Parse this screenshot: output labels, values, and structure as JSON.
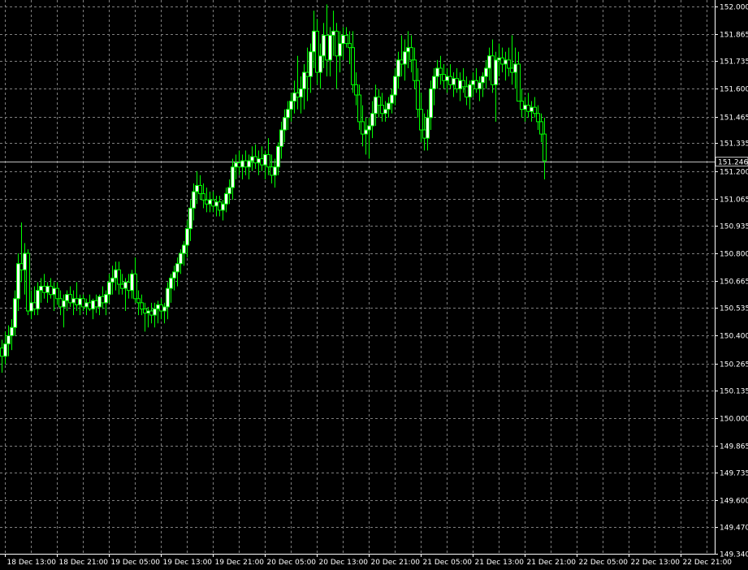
{
  "chart_data": {
    "type": "candlestick",
    "grid": true,
    "colors": {
      "background": "#000000",
      "grid": "#7f7f7f",
      "bull_body": "#ffffff",
      "bear_body": "#000000",
      "candle_outline": "#00ff00",
      "wick": "#00ff00",
      "axis_text": "#ffffff",
      "bid_line": "#c0c0c0"
    },
    "ylim": [
      149.34,
      152.0
    ],
    "y_ticks": [
      "152.000",
      "151.865",
      "151.735",
      "151.600",
      "151.465",
      "151.335",
      "151.200",
      "151.065",
      "150.935",
      "150.800",
      "150.665",
      "150.535",
      "150.400",
      "150.265",
      "150.135",
      "150.000",
      "149.865",
      "149.735",
      "149.600",
      "149.470",
      "149.340"
    ],
    "y_tick_values": [
      152.0,
      151.865,
      151.735,
      151.6,
      151.465,
      151.335,
      151.2,
      151.065,
      150.935,
      150.8,
      150.665,
      150.535,
      150.4,
      150.265,
      150.135,
      150.0,
      149.865,
      149.735,
      149.6,
      149.47,
      149.34
    ],
    "x_ticks": [
      "18 Dec 13:00",
      "18 Dec 21:00",
      "19 Dec 05:00",
      "19 Dec 13:00",
      "19 Dec 21:00",
      "20 Dec 05:00",
      "20 Dec 13:00",
      "20 Dec 21:00",
      "21 Dec 05:00",
      "21 Dec 13:00",
      "21 Dec 21:00",
      "22 Dec 05:00",
      "22 Dec 13:00",
      "22 Dec 21:00"
    ],
    "x_tick_candle_index": [
      1,
      17,
      33,
      49,
      65,
      81,
      97,
      113,
      129,
      145,
      161,
      177,
      193,
      209
    ],
    "current_price": "151.246",
    "current_price_value": 151.246,
    "candles": [
      {
        "o": 150.34,
        "h": 150.38,
        "l": 150.22,
        "c": 150.3
      },
      {
        "o": 150.3,
        "h": 150.42,
        "l": 150.26,
        "c": 150.36
      },
      {
        "o": 150.36,
        "h": 150.45,
        "l": 150.3,
        "c": 150.4
      },
      {
        "o": 150.4,
        "h": 150.48,
        "l": 150.33,
        "c": 150.44
      },
      {
        "o": 150.44,
        "h": 150.62,
        "l": 150.4,
        "c": 150.58
      },
      {
        "o": 150.58,
        "h": 150.8,
        "l": 150.52,
        "c": 150.75
      },
      {
        "o": 150.75,
        "h": 150.95,
        "l": 150.66,
        "c": 150.72
      },
      {
        "o": 150.72,
        "h": 150.85,
        "l": 150.6,
        "c": 150.8
      },
      {
        "o": 150.8,
        "h": 150.82,
        "l": 150.5,
        "c": 150.52
      },
      {
        "o": 150.52,
        "h": 150.62,
        "l": 150.48,
        "c": 150.56
      },
      {
        "o": 150.56,
        "h": 150.64,
        "l": 150.5,
        "c": 150.53
      },
      {
        "o": 150.53,
        "h": 150.66,
        "l": 150.5,
        "c": 150.62
      },
      {
        "o": 150.62,
        "h": 150.68,
        "l": 150.56,
        "c": 150.64
      },
      {
        "o": 150.64,
        "h": 150.7,
        "l": 150.58,
        "c": 150.61
      },
      {
        "o": 150.61,
        "h": 150.66,
        "l": 150.56,
        "c": 150.64
      },
      {
        "o": 150.64,
        "h": 150.68,
        "l": 150.58,
        "c": 150.6
      },
      {
        "o": 150.6,
        "h": 150.66,
        "l": 150.52,
        "c": 150.63
      },
      {
        "o": 150.63,
        "h": 150.66,
        "l": 150.55,
        "c": 150.58
      },
      {
        "o": 150.58,
        "h": 150.62,
        "l": 150.5,
        "c": 150.54
      },
      {
        "o": 150.54,
        "h": 150.6,
        "l": 150.44,
        "c": 150.57
      },
      {
        "o": 150.57,
        "h": 150.62,
        "l": 150.52,
        "c": 150.6
      },
      {
        "o": 150.6,
        "h": 150.64,
        "l": 150.54,
        "c": 150.56
      },
      {
        "o": 150.56,
        "h": 150.62,
        "l": 150.5,
        "c": 150.58
      },
      {
        "o": 150.58,
        "h": 150.66,
        "l": 150.52,
        "c": 150.55
      },
      {
        "o": 150.55,
        "h": 150.6,
        "l": 150.5,
        "c": 150.58
      },
      {
        "o": 150.58,
        "h": 150.6,
        "l": 150.52,
        "c": 150.54
      },
      {
        "o": 150.54,
        "h": 150.58,
        "l": 150.5,
        "c": 150.56
      },
      {
        "o": 150.56,
        "h": 150.6,
        "l": 150.52,
        "c": 150.53
      },
      {
        "o": 150.53,
        "h": 150.58,
        "l": 150.48,
        "c": 150.57
      },
      {
        "o": 150.57,
        "h": 150.6,
        "l": 150.51,
        "c": 150.54
      },
      {
        "o": 150.54,
        "h": 150.6,
        "l": 150.5,
        "c": 150.59
      },
      {
        "o": 150.59,
        "h": 150.64,
        "l": 150.53,
        "c": 150.56
      },
      {
        "o": 150.56,
        "h": 150.62,
        "l": 150.5,
        "c": 150.6
      },
      {
        "o": 150.6,
        "h": 150.7,
        "l": 150.56,
        "c": 150.66
      },
      {
        "o": 150.66,
        "h": 150.74,
        "l": 150.6,
        "c": 150.68
      },
      {
        "o": 150.68,
        "h": 150.76,
        "l": 150.62,
        "c": 150.72
      },
      {
        "o": 150.72,
        "h": 150.76,
        "l": 150.6,
        "c": 150.65
      },
      {
        "o": 150.65,
        "h": 150.7,
        "l": 150.6,
        "c": 150.63
      },
      {
        "o": 150.63,
        "h": 150.68,
        "l": 150.52,
        "c": 150.66
      },
      {
        "o": 150.66,
        "h": 150.7,
        "l": 150.58,
        "c": 150.62
      },
      {
        "o": 150.62,
        "h": 150.72,
        "l": 150.58,
        "c": 150.7
      },
      {
        "o": 150.7,
        "h": 150.78,
        "l": 150.56,
        "c": 150.58
      },
      {
        "o": 150.58,
        "h": 150.62,
        "l": 150.5,
        "c": 150.56
      },
      {
        "o": 150.56,
        "h": 150.6,
        "l": 150.5,
        "c": 150.53
      },
      {
        "o": 150.53,
        "h": 150.56,
        "l": 150.42,
        "c": 150.51
      },
      {
        "o": 150.51,
        "h": 150.54,
        "l": 150.44,
        "c": 150.52
      },
      {
        "o": 150.52,
        "h": 150.56,
        "l": 150.46,
        "c": 150.5
      },
      {
        "o": 150.5,
        "h": 150.56,
        "l": 150.44,
        "c": 150.53
      },
      {
        "o": 150.53,
        "h": 150.57,
        "l": 150.46,
        "c": 150.55
      },
      {
        "o": 150.55,
        "h": 150.58,
        "l": 150.48,
        "c": 150.52
      },
      {
        "o": 150.52,
        "h": 150.56,
        "l": 150.46,
        "c": 150.54
      },
      {
        "o": 150.54,
        "h": 150.66,
        "l": 150.48,
        "c": 150.63
      },
      {
        "o": 150.63,
        "h": 150.7,
        "l": 150.56,
        "c": 150.68
      },
      {
        "o": 150.68,
        "h": 150.74,
        "l": 150.62,
        "c": 150.71
      },
      {
        "o": 150.71,
        "h": 150.78,
        "l": 150.64,
        "c": 150.75
      },
      {
        "o": 150.75,
        "h": 150.82,
        "l": 150.7,
        "c": 150.8
      },
      {
        "o": 150.8,
        "h": 150.86,
        "l": 150.74,
        "c": 150.84
      },
      {
        "o": 150.84,
        "h": 150.96,
        "l": 150.78,
        "c": 150.92
      },
      {
        "o": 150.92,
        "h": 151.06,
        "l": 150.86,
        "c": 151.02
      },
      {
        "o": 151.02,
        "h": 151.14,
        "l": 150.96,
        "c": 151.1
      },
      {
        "o": 151.1,
        "h": 151.2,
        "l": 151.04,
        "c": 151.13
      },
      {
        "o": 151.13,
        "h": 151.18,
        "l": 151.06,
        "c": 151.09
      },
      {
        "o": 151.09,
        "h": 151.14,
        "l": 151.02,
        "c": 151.06
      },
      {
        "o": 151.06,
        "h": 151.12,
        "l": 151.0,
        "c": 151.04
      },
      {
        "o": 151.04,
        "h": 151.1,
        "l": 151.0,
        "c": 151.06
      },
      {
        "o": 151.06,
        "h": 151.1,
        "l": 151.0,
        "c": 151.03
      },
      {
        "o": 151.03,
        "h": 151.08,
        "l": 150.98,
        "c": 151.05
      },
      {
        "o": 151.05,
        "h": 151.08,
        "l": 150.98,
        "c": 151.01
      },
      {
        "o": 151.01,
        "h": 151.06,
        "l": 150.96,
        "c": 151.04
      },
      {
        "o": 151.04,
        "h": 151.12,
        "l": 151.0,
        "c": 151.09
      },
      {
        "o": 151.09,
        "h": 151.16,
        "l": 151.04,
        "c": 151.12
      },
      {
        "o": 151.12,
        "h": 151.26,
        "l": 151.06,
        "c": 151.22
      },
      {
        "o": 151.22,
        "h": 151.28,
        "l": 151.16,
        "c": 151.24
      },
      {
        "o": 151.24,
        "h": 151.3,
        "l": 151.18,
        "c": 151.22
      },
      {
        "o": 151.22,
        "h": 151.28,
        "l": 151.16,
        "c": 151.25
      },
      {
        "o": 151.25,
        "h": 151.3,
        "l": 151.18,
        "c": 151.22
      },
      {
        "o": 151.22,
        "h": 151.28,
        "l": 151.16,
        "c": 151.25
      },
      {
        "o": 151.25,
        "h": 151.32,
        "l": 151.2,
        "c": 151.27
      },
      {
        "o": 151.27,
        "h": 151.33,
        "l": 151.21,
        "c": 151.24
      },
      {
        "o": 151.24,
        "h": 151.3,
        "l": 151.18,
        "c": 151.26
      },
      {
        "o": 151.26,
        "h": 151.32,
        "l": 151.2,
        "c": 151.23
      },
      {
        "o": 151.23,
        "h": 151.3,
        "l": 151.16,
        "c": 151.28
      },
      {
        "o": 151.28,
        "h": 151.36,
        "l": 151.18,
        "c": 151.22
      },
      {
        "o": 151.22,
        "h": 151.28,
        "l": 151.14,
        "c": 151.18
      },
      {
        "o": 151.18,
        "h": 151.26,
        "l": 151.12,
        "c": 151.22
      },
      {
        "o": 151.22,
        "h": 151.34,
        "l": 151.18,
        "c": 151.32
      },
      {
        "o": 151.32,
        "h": 151.44,
        "l": 151.26,
        "c": 151.4
      },
      {
        "o": 151.4,
        "h": 151.5,
        "l": 151.34,
        "c": 151.46
      },
      {
        "o": 151.46,
        "h": 151.54,
        "l": 151.4,
        "c": 151.5
      },
      {
        "o": 151.5,
        "h": 151.58,
        "l": 151.44,
        "c": 151.54
      },
      {
        "o": 151.54,
        "h": 151.64,
        "l": 151.48,
        "c": 151.58
      },
      {
        "o": 151.58,
        "h": 151.76,
        "l": 151.5,
        "c": 151.56
      },
      {
        "o": 151.56,
        "h": 151.66,
        "l": 151.48,
        "c": 151.6
      },
      {
        "o": 151.6,
        "h": 151.72,
        "l": 151.5,
        "c": 151.68
      },
      {
        "o": 151.68,
        "h": 151.8,
        "l": 151.54,
        "c": 151.66
      },
      {
        "o": 151.66,
        "h": 151.82,
        "l": 151.58,
        "c": 151.78
      },
      {
        "o": 151.78,
        "h": 151.98,
        "l": 151.7,
        "c": 151.88
      },
      {
        "o": 151.88,
        "h": 151.94,
        "l": 151.62,
        "c": 151.68
      },
      {
        "o": 151.68,
        "h": 151.82,
        "l": 151.6,
        "c": 151.76
      },
      {
        "o": 151.76,
        "h": 151.92,
        "l": 151.7,
        "c": 151.86
      },
      {
        "o": 151.86,
        "h": 152.01,
        "l": 151.66,
        "c": 151.74
      },
      {
        "o": 151.74,
        "h": 151.9,
        "l": 151.66,
        "c": 151.86
      },
      {
        "o": 151.86,
        "h": 151.98,
        "l": 151.76,
        "c": 151.88
      },
      {
        "o": 151.88,
        "h": 151.92,
        "l": 151.6,
        "c": 151.76
      },
      {
        "o": 151.76,
        "h": 151.88,
        "l": 151.68,
        "c": 151.82
      },
      {
        "o": 151.82,
        "h": 151.9,
        "l": 151.74,
        "c": 151.86
      },
      {
        "o": 151.86,
        "h": 151.9,
        "l": 151.8,
        "c": 151.82
      },
      {
        "o": 151.82,
        "h": 151.88,
        "l": 151.72,
        "c": 151.8
      },
      {
        "o": 151.8,
        "h": 151.88,
        "l": 151.58,
        "c": 151.62
      },
      {
        "o": 151.62,
        "h": 151.68,
        "l": 151.52,
        "c": 151.57
      },
      {
        "o": 151.57,
        "h": 151.62,
        "l": 151.4,
        "c": 151.44
      },
      {
        "o": 151.44,
        "h": 151.52,
        "l": 151.32,
        "c": 151.38
      },
      {
        "o": 151.38,
        "h": 151.46,
        "l": 151.28,
        "c": 151.4
      },
      {
        "o": 151.4,
        "h": 151.46,
        "l": 151.26,
        "c": 151.42
      },
      {
        "o": 151.42,
        "h": 151.54,
        "l": 151.36,
        "c": 151.48
      },
      {
        "o": 151.48,
        "h": 151.62,
        "l": 151.42,
        "c": 151.56
      },
      {
        "o": 151.56,
        "h": 151.6,
        "l": 151.46,
        "c": 151.52
      },
      {
        "o": 151.52,
        "h": 151.58,
        "l": 151.44,
        "c": 151.48
      },
      {
        "o": 151.48,
        "h": 151.54,
        "l": 151.44,
        "c": 151.5
      },
      {
        "o": 151.5,
        "h": 151.56,
        "l": 151.46,
        "c": 151.53
      },
      {
        "o": 151.53,
        "h": 151.6,
        "l": 151.48,
        "c": 151.57
      },
      {
        "o": 151.57,
        "h": 151.7,
        "l": 151.52,
        "c": 151.66
      },
      {
        "o": 151.66,
        "h": 151.78,
        "l": 151.6,
        "c": 151.74
      },
      {
        "o": 151.74,
        "h": 151.86,
        "l": 151.66,
        "c": 151.72
      },
      {
        "o": 151.72,
        "h": 151.84,
        "l": 151.64,
        "c": 151.78
      },
      {
        "o": 151.78,
        "h": 151.88,
        "l": 151.7,
        "c": 151.8
      },
      {
        "o": 151.8,
        "h": 151.86,
        "l": 151.68,
        "c": 151.74
      },
      {
        "o": 151.74,
        "h": 151.8,
        "l": 151.6,
        "c": 151.64
      },
      {
        "o": 151.64,
        "h": 151.7,
        "l": 151.46,
        "c": 151.5
      },
      {
        "o": 151.5,
        "h": 151.58,
        "l": 151.34,
        "c": 151.4
      },
      {
        "o": 151.4,
        "h": 151.48,
        "l": 151.3,
        "c": 151.36
      },
      {
        "o": 151.36,
        "h": 151.5,
        "l": 151.3,
        "c": 151.46
      },
      {
        "o": 151.46,
        "h": 151.64,
        "l": 151.4,
        "c": 151.6
      },
      {
        "o": 151.6,
        "h": 151.7,
        "l": 151.52,
        "c": 151.66
      },
      {
        "o": 151.66,
        "h": 151.74,
        "l": 151.6,
        "c": 151.7
      },
      {
        "o": 151.7,
        "h": 151.76,
        "l": 151.62,
        "c": 151.67
      },
      {
        "o": 151.67,
        "h": 151.72,
        "l": 151.6,
        "c": 151.64
      },
      {
        "o": 151.64,
        "h": 151.7,
        "l": 151.58,
        "c": 151.66
      },
      {
        "o": 151.66,
        "h": 151.72,
        "l": 151.6,
        "c": 151.62
      },
      {
        "o": 151.62,
        "h": 151.68,
        "l": 151.56,
        "c": 151.65
      },
      {
        "o": 151.65,
        "h": 151.7,
        "l": 151.58,
        "c": 151.6
      },
      {
        "o": 151.6,
        "h": 151.68,
        "l": 151.54,
        "c": 151.64
      },
      {
        "o": 151.64,
        "h": 151.7,
        "l": 151.58,
        "c": 151.61
      },
      {
        "o": 151.61,
        "h": 151.66,
        "l": 151.52,
        "c": 151.56
      },
      {
        "o": 151.56,
        "h": 151.64,
        "l": 151.5,
        "c": 151.62
      },
      {
        "o": 151.62,
        "h": 151.68,
        "l": 151.56,
        "c": 151.64
      },
      {
        "o": 151.64,
        "h": 151.7,
        "l": 151.58,
        "c": 151.6
      },
      {
        "o": 151.6,
        "h": 151.66,
        "l": 151.54,
        "c": 151.63
      },
      {
        "o": 151.63,
        "h": 151.68,
        "l": 151.56,
        "c": 151.66
      },
      {
        "o": 151.66,
        "h": 151.74,
        "l": 151.6,
        "c": 151.7
      },
      {
        "o": 151.7,
        "h": 151.8,
        "l": 151.64,
        "c": 151.76
      },
      {
        "o": 151.76,
        "h": 151.84,
        "l": 151.58,
        "c": 151.62
      },
      {
        "o": 151.62,
        "h": 151.78,
        "l": 151.44,
        "c": 151.74
      },
      {
        "o": 151.74,
        "h": 151.82,
        "l": 151.66,
        "c": 151.75
      },
      {
        "o": 151.75,
        "h": 151.8,
        "l": 151.68,
        "c": 151.72
      },
      {
        "o": 151.72,
        "h": 151.78,
        "l": 151.64,
        "c": 151.74
      },
      {
        "o": 151.74,
        "h": 151.8,
        "l": 151.66,
        "c": 151.7
      },
      {
        "o": 151.7,
        "h": 151.86,
        "l": 151.62,
        "c": 151.68
      },
      {
        "o": 151.68,
        "h": 151.8,
        "l": 151.6,
        "c": 151.72
      },
      {
        "o": 151.72,
        "h": 151.78,
        "l": 151.58,
        "c": 151.54
      },
      {
        "o": 151.54,
        "h": 151.6,
        "l": 151.46,
        "c": 151.5
      },
      {
        "o": 151.5,
        "h": 151.56,
        "l": 151.44,
        "c": 151.52
      },
      {
        "o": 151.52,
        "h": 151.58,
        "l": 151.46,
        "c": 151.49
      },
      {
        "o": 151.49,
        "h": 151.54,
        "l": 151.44,
        "c": 151.51
      },
      {
        "o": 151.51,
        "h": 151.56,
        "l": 151.46,
        "c": 151.48
      },
      {
        "o": 151.48,
        "h": 151.52,
        "l": 151.4,
        "c": 151.44
      },
      {
        "o": 151.44,
        "h": 151.48,
        "l": 151.34,
        "c": 151.38
      },
      {
        "o": 151.38,
        "h": 151.46,
        "l": 151.16,
        "c": 151.25
      }
    ]
  }
}
